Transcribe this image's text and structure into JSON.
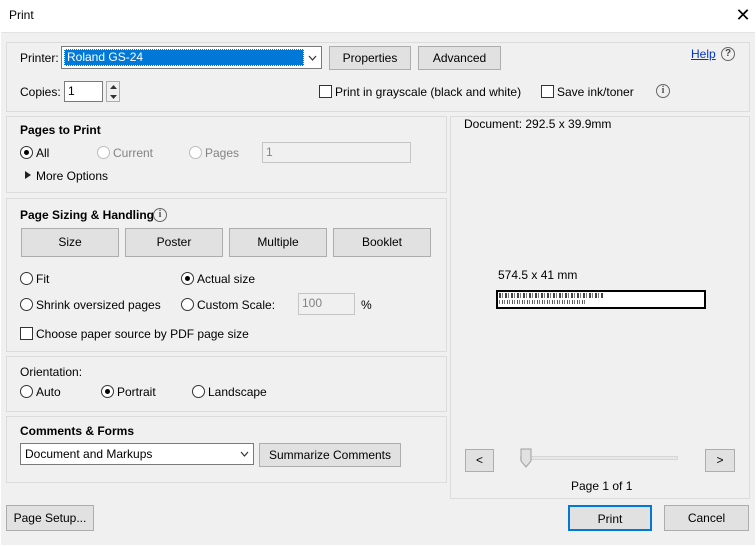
{
  "window": {
    "title": "Print",
    "close_glyph": "✕"
  },
  "printer": {
    "label": "Printer:",
    "selected": "Roland GS-24",
    "properties_label": "Properties",
    "advanced_label": "Advanced",
    "help_label": "Help",
    "help_glyph": "?"
  },
  "copies": {
    "label": "Copies:",
    "value": "1",
    "grayscale_label": "Print in grayscale (black and white)",
    "grayscale_checked": false,
    "save_ink_label": "Save ink/toner",
    "save_ink_checked": false,
    "info_glyph": "i"
  },
  "pages_to_print": {
    "title": "Pages to Print",
    "all_label": "All",
    "current_label": "Current",
    "pages_label": "Pages",
    "pages_value": "1",
    "more_options_label": "More Options"
  },
  "sizing": {
    "title": "Page Sizing & Handling",
    "info_glyph": "i",
    "tabs": [
      "Size",
      "Poster",
      "Multiple",
      "Booklet"
    ],
    "fit_label": "Fit",
    "actual_size_label": "Actual size",
    "shrink_label": "Shrink oversized pages",
    "custom_scale_label": "Custom Scale:",
    "custom_scale_value": "100",
    "percent": "%",
    "paper_source_label": "Choose paper source by PDF page size",
    "selected": "Actual size"
  },
  "orientation": {
    "title": "Orientation:",
    "auto_label": "Auto",
    "portrait_label": "Portrait",
    "landscape_label": "Landscape",
    "selected": "Portrait"
  },
  "comments": {
    "title": "Comments & Forms",
    "selected": "Document and Markups",
    "summarize_label": "Summarize Comments"
  },
  "preview": {
    "document_size": "Document: 292.5 x 39.9mm",
    "paper_size": "574.5 x 41 mm",
    "preview_text_1": "©¦ ©¦ ©¦ ©¦ ¦¦ ¦©",
    "prev_label": "<",
    "next_label": ">",
    "page_indicator": "Page 1 of 1",
    "slider_position": 0
  },
  "footer": {
    "page_setup_label": "Page Setup...",
    "print_label": "Print",
    "cancel_label": "Cancel"
  },
  "colors": {
    "accent": "#0078d7",
    "selection": "#0078d7",
    "link": "#0033cc"
  }
}
